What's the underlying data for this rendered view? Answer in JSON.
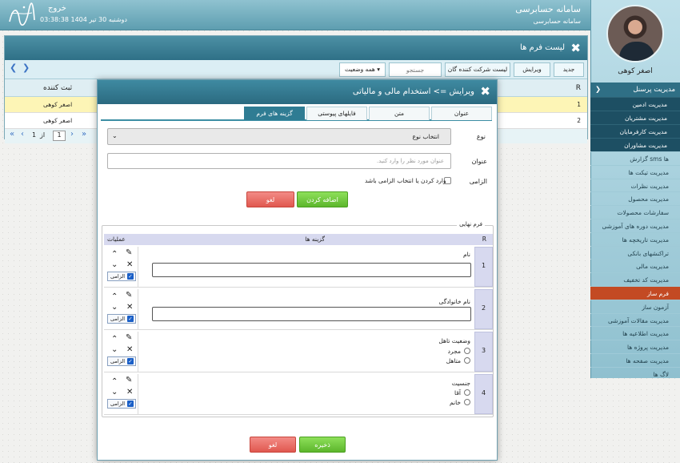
{
  "header": {
    "app_title": "سامانه حسابرسی",
    "app_subtitle": "سامانه حسابرسی",
    "logout": "خروج",
    "date": "دوشنبه 30 تیر 1404",
    "time": "03:38:38"
  },
  "sidebar": {
    "user_name": "اصغر کوهی",
    "section_title": "مدیریت پرسنل",
    "sub_items": [
      "مدیریت ادمین",
      "مدیریت مشتریان",
      "مدیریت کارفرمایان",
      "مدیریت مشاوران"
    ],
    "items": [
      "گزارش sms ها",
      "مدیریت تیکت ها",
      "مدیریت نظرات",
      "مدیریت محصول",
      "سفارشات محصولات",
      "مدیریت دوره های آموزشی",
      "مدیریت تاریخچه ها",
      "تراکنشهای بانکی",
      "مدیریت مالی",
      "مدیریت کد تخفیف",
      "فرم ساز",
      "آزمون ساز",
      "مدیریت مقالات آموزشی",
      "مدیریت اطلاعیه ها",
      "مدیریت پروژه ها",
      "مدیریت صفحه ها",
      "لاگ ها"
    ],
    "active_item": "فرم ساز"
  },
  "list_window": {
    "title": "لیست فرم ها",
    "toolbar": {
      "new": "جدید",
      "edit": "ویرایش",
      "participants": "لیست شرکت کننده گان",
      "search_placeholder": "جستجو",
      "status_select": "همه وضعیت"
    },
    "columns": {
      "r": "R",
      "creator": "ثبت کننده"
    },
    "rows": [
      {
        "r": "1",
        "creator": "اصغر کوهی"
      },
      {
        "r": "2",
        "creator": "اصغر کوهی"
      }
    ],
    "pager": {
      "page": "1",
      "of": "از",
      "total": "1"
    }
  },
  "modal": {
    "title": "ویرایش => استخدام مالی و مالیاتی",
    "tabs": [
      "عنوان",
      "متن",
      "فایلهای پیوستی",
      "گزینه های فرم"
    ],
    "active_tab": "گزینه های فرم",
    "form": {
      "type_label": "نوع",
      "type_value": "انتخاب نوع",
      "title_label": "عنوان",
      "title_placeholder": "عنوان مورد نظر را وارد کنید.",
      "required_label": "الزامی",
      "required_text": "وارد کردن یا انتخاب الزامی باشد",
      "add_button": "اضافه کردن",
      "cancel_button": "لغو"
    },
    "final_form": {
      "legend": "فرم نهایی",
      "columns": {
        "r": "R",
        "options": "گزینه ها",
        "operations": "عملیات"
      },
      "required_badge": "الزامی",
      "rows": [
        {
          "r": "1",
          "label": "نام",
          "kind": "text"
        },
        {
          "r": "2",
          "label": "نام خانوادگی",
          "kind": "text"
        },
        {
          "r": "3",
          "label": "وضعیت تاهل",
          "kind": "radio",
          "options": [
            "مجرد",
            "متاهل"
          ]
        },
        {
          "r": "4",
          "label": "جنسیت",
          "kind": "radio",
          "options": [
            "آقا",
            "خانم"
          ]
        }
      ]
    },
    "footer": {
      "save": "ذخیره",
      "cancel": "لغو"
    }
  },
  "colors": {
    "header": "#5e9eb0",
    "modal_title": "#2b6a80",
    "active_menu": "#c34a23",
    "green_button": "#5cb62c",
    "red_button": "#e0584f"
  }
}
